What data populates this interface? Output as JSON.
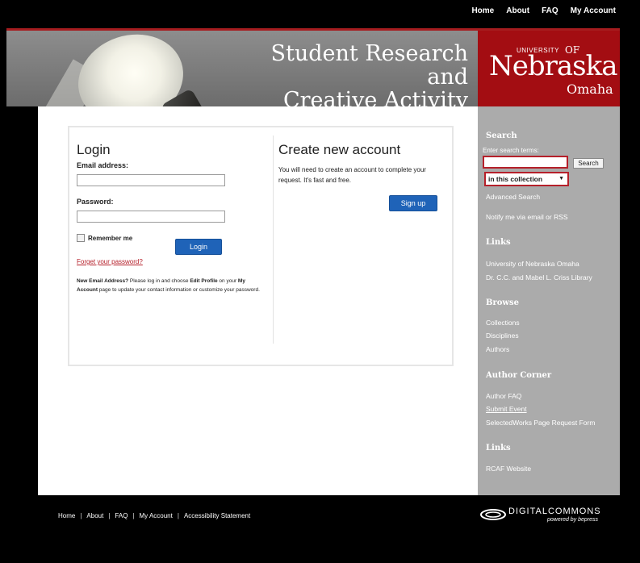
{
  "topnav": [
    {
      "label": "Home"
    },
    {
      "label": "About"
    },
    {
      "label": "FAQ"
    },
    {
      "label": "My Account"
    }
  ],
  "banner": {
    "title_line1": "Student Research and",
    "title_line2": "Creative Activity Fair"
  },
  "logo": {
    "university": "UNIVERSITY",
    "of": "OF",
    "name": "Nebraska",
    "city": "Omaha"
  },
  "login": {
    "heading": "Login",
    "email_label": "Email address:",
    "email_value": "",
    "password_label": "Password:",
    "password_value": "",
    "remember_label": "Remember me",
    "login_button": "Login",
    "forgot_link": "Forget your password?",
    "note_bold1": "New Email Address?",
    "note_text1": " Please log in and choose ",
    "note_bold2": "Edit Profile",
    "note_text2": " on your ",
    "note_bold3": "My Account",
    "note_text3": " page to update your contact information or customize your password."
  },
  "create": {
    "heading": "Create new account",
    "description": "You will need to create an account to complete your request. It's fast and free.",
    "signup_button": "Sign up"
  },
  "sidebar": {
    "search_heading": "Search",
    "search_label": "Enter search terms:",
    "search_value": "",
    "search_button": "Search",
    "scope_select": "in this collection",
    "advanced_link": "Advanced Search",
    "notify_link": "Notify me via email or RSS",
    "links_heading": "Links",
    "links": [
      "University of Nebraska Omaha",
      "Dr. C.C. and Mabel L. Criss Library"
    ],
    "browse_heading": "Browse",
    "browse": [
      "Collections",
      "Disciplines",
      "Authors"
    ],
    "author_heading": "Author Corner",
    "author_links": [
      "Author FAQ",
      "Submit Event",
      "SelectedWorks Page Request Form"
    ],
    "links2_heading": "Links",
    "links2": [
      "RCAF Website"
    ]
  },
  "footer": {
    "links": [
      "Home",
      "About",
      "FAQ",
      "My Account",
      "Accessibility Statement"
    ],
    "separator": "|"
  },
  "digital_commons": {
    "name": "DIGITALCOMMONS",
    "tagline": "powered by bepress"
  },
  "colors": {
    "brand_red": "#a30d12",
    "button_blue": "#1f63b8",
    "sidebar_gray": "#ababab"
  }
}
